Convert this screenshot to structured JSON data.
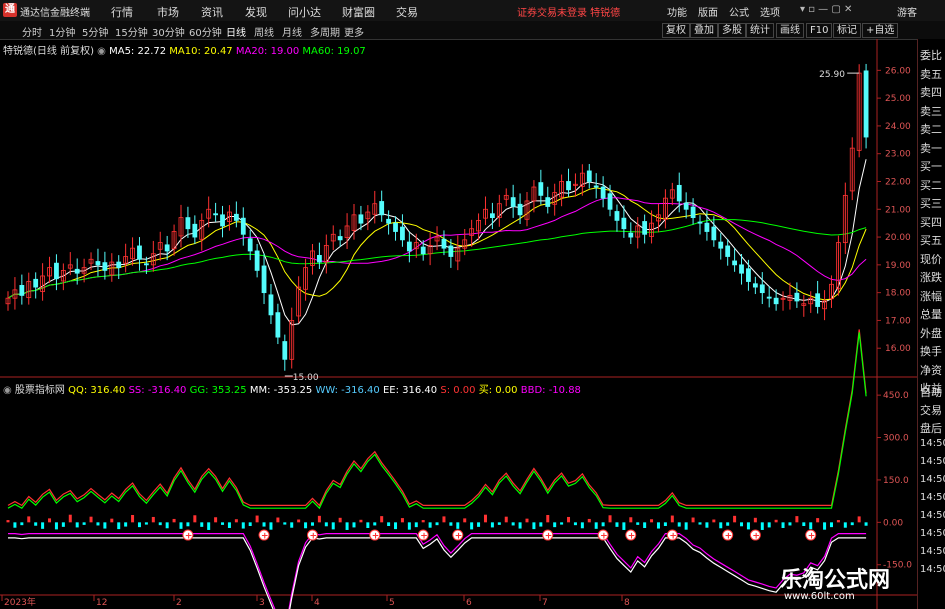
{
  "app": {
    "logo_glyph": "通",
    "title": "通达信金融终端"
  },
  "menu": [
    "行情",
    "市场",
    "资讯",
    "发现",
    "问小达",
    "财富圈",
    "交易"
  ],
  "warning": "证券交易未登录 特锐德",
  "right_menu": [
    "功能",
    "版面",
    "公式",
    "选项",
    "游客"
  ],
  "periods": [
    "分时",
    "1分钟",
    "5分钟",
    "15分钟",
    "30分钟",
    "60分钟",
    "日线",
    "周线",
    "月线",
    "多周期",
    "更多"
  ],
  "active_period": "日线",
  "toolbar": [
    "复权",
    "叠加",
    "多股",
    "统计",
    "画线",
    "F10",
    "标记",
    "+自选"
  ],
  "main_legend": {
    "stock": "特锐德(日线 前复权)",
    "ma5": "MA5: 22.72",
    "ma10": "MA10: 20.47",
    "ma20": "MA20: 19.00",
    "ma60": "MA60: 19.07"
  },
  "indicator_legend": {
    "name": "股票指标网",
    "qq": "QQ: 316.40",
    "ss": "SS: -316.40",
    "gg": "GG: 353.25",
    "mm": "MM: -353.25",
    "ww": "WW: -316.40",
    "ee": "EE: 316.40",
    "s": "S: 0.00",
    "buy": "买: 0.00",
    "bbd": "BBD: -10.88"
  },
  "price_axis": [
    "26.00",
    "25.00",
    "24.00",
    "23.00",
    "22.00",
    "21.00",
    "20.00",
    "19.00",
    "18.00",
    "17.00",
    "16.00"
  ],
  "indicator_axis": [
    "450.0",
    "300.0",
    "150.0",
    "0.00",
    "-150.0"
  ],
  "annotations": {
    "high": "25.90",
    "low": "15.00"
  },
  "x_labels": [
    "2023年",
    "12",
    "2",
    "3",
    "4",
    "5",
    "6",
    "7",
    "8"
  ],
  "side_panel": [
    "委比",
    "卖五",
    "卖四",
    "卖三",
    "卖二",
    "卖一",
    "买一",
    "买二",
    "买三",
    "买四",
    "买五",
    "现价",
    "涨跌",
    "涨幅",
    "总量",
    "外盘",
    "换手",
    "净资",
    "收益"
  ],
  "side_panel2": [
    "自动",
    "交易",
    "盘后",
    "14:50",
    "14:50",
    "14:50",
    "14:50",
    "14:50",
    "14:50",
    "14:50",
    "14:50"
  ],
  "colors": {
    "ma5": "#ffffff",
    "ma10": "#ffff00",
    "ma20": "#ff00ff",
    "ma60": "#00ff00",
    "up": "#ff3232",
    "down": "#54fcfc",
    "axis": "#aa2222"
  },
  "chart_data": {
    "type": "candlestick",
    "ylim": [
      15,
      26.3
    ],
    "close_series": [
      17.8,
      18.1,
      17.9,
      18.4,
      18.2,
      18.6,
      18.9,
      18.5,
      18.8,
      19.0,
      18.7,
      18.9,
      19.2,
      19.0,
      18.8,
      19.1,
      18.9,
      19.3,
      19.6,
      19.2,
      19.0,
      19.4,
      19.8,
      19.5,
      20.2,
      20.7,
      20.3,
      20.0,
      20.6,
      21.0,
      20.8,
      20.4,
      20.9,
      20.6,
      20.1,
      19.5,
      18.8,
      18.0,
      17.2,
      16.4,
      15.6,
      17.0,
      18.2,
      18.9,
      19.5,
      19.1,
      19.7,
      20.1,
      19.9,
      20.4,
      20.8,
      20.5,
      20.9,
      21.2,
      20.8,
      20.5,
      20.2,
      19.9,
      19.5,
      19.8,
      19.4,
      19.7,
      20.0,
      19.6,
      19.3,
      19.6,
      19.9,
      20.3,
      20.6,
      21.0,
      20.7,
      21.2,
      21.5,
      21.1,
      20.8,
      21.3,
      21.8,
      21.5,
      21.1,
      21.6,
      22.0,
      21.7,
      21.9,
      22.3,
      22.0,
      21.8,
      21.4,
      21.0,
      20.6,
      20.3,
      20.0,
      20.4,
      20.1,
      20.5,
      20.8,
      21.4,
      21.7,
      21.3,
      21.0,
      20.7,
      20.5,
      20.2,
      19.9,
      19.6,
      19.3,
      19.0,
      18.7,
      18.4,
      18.2,
      18.0,
      17.8,
      17.6,
      17.8,
      17.9,
      17.7,
      17.6,
      17.8,
      17.5,
      17.7,
      18.3,
      19.8,
      21.5,
      23.2,
      25.9,
      23.6
    ],
    "indicator": {
      "ylim": [
        -250,
        500
      ]
    }
  }
}
